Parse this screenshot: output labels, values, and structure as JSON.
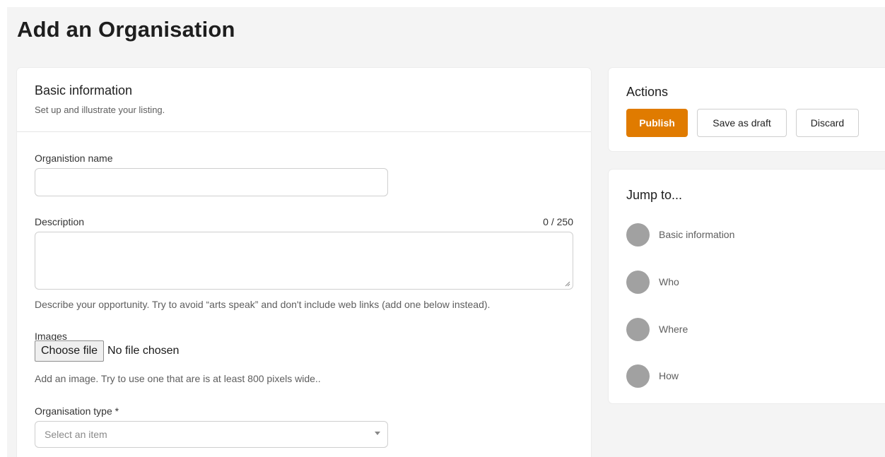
{
  "page": {
    "title": "Add an Organisation"
  },
  "basic_info": {
    "title": "Basic information",
    "subtitle": "Set up and illustrate your listing.",
    "org_name": {
      "label": "Organistion name",
      "value": "",
      "placeholder": ""
    },
    "description": {
      "label": "Description",
      "counter": "0 / 250",
      "value": "",
      "help": "Describe your opportunity. Try to avoid “arts speak” and don't include web links (add one below instead)."
    },
    "images": {
      "label": "Images",
      "button_label": "Choose file",
      "status": "No file chosen",
      "help": "Add an image. Try to use one that are is at least 800 pixels wide.."
    },
    "org_type": {
      "label": "Organisation type *",
      "placeholder": "Select an item"
    }
  },
  "actions": {
    "title": "Actions",
    "publish_label": "Publish",
    "save_draft_label": "Save as draft",
    "discard_label": "Discard"
  },
  "jump_to": {
    "title": "Jump to...",
    "items": [
      {
        "label": "Basic information"
      },
      {
        "label": "Who"
      },
      {
        "label": "Where"
      },
      {
        "label": "How"
      }
    ]
  },
  "colors": {
    "accent": "#e07b00",
    "background": "#f4f4f4",
    "card": "#ffffff",
    "dot": "#a1a1a1"
  }
}
